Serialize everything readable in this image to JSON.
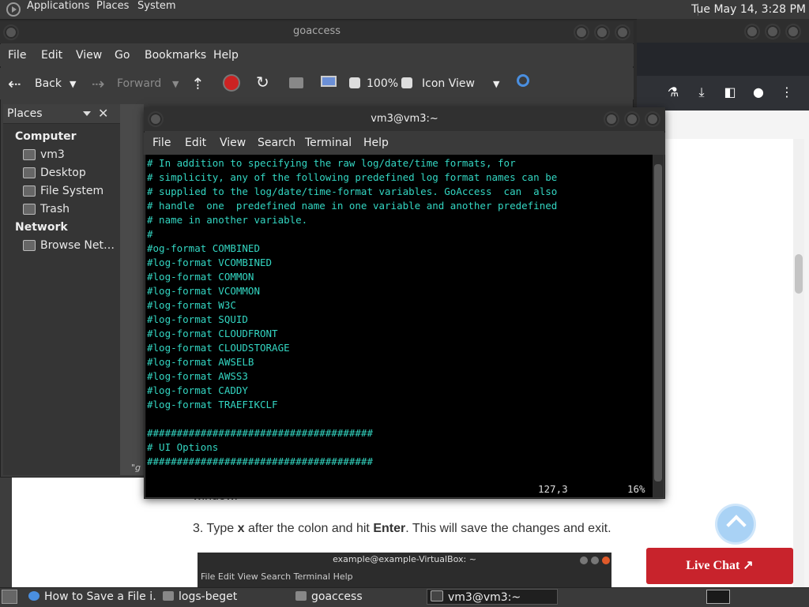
{
  "top_panel": {
    "menus": [
      "Applications",
      "Places",
      "System"
    ],
    "clock": "Tue May 14,  3:28 PM"
  },
  "file_manager": {
    "title": "goaccess",
    "menus": [
      "File",
      "Edit",
      "View",
      "Go",
      "Bookmarks",
      "Help"
    ],
    "toolbar": {
      "back": "Back",
      "forward": "Forward",
      "zoom": "100%",
      "view_mode": "Icon View"
    },
    "places": {
      "header": "Places",
      "sections": [
        {
          "title": "Computer",
          "items": [
            "vm3",
            "Desktop",
            "File System",
            "Trash"
          ]
        },
        {
          "title": "Network",
          "items": [
            "Browse Net…"
          ]
        }
      ]
    },
    "status_fragment": "\"g"
  },
  "terminal": {
    "title": "vm3@vm3:~",
    "menus": [
      "File",
      "Edit",
      "View",
      "Search",
      "Terminal",
      "Help"
    ],
    "lines": [
      "# In addition to specifying the raw log/date/time formats, for",
      "# simplicity, any of the following predefined log format names can be",
      "# supplied to the log/date/time-format variables. GoAccess  can  also",
      "# handle  one  predefined name in one variable and another predefined",
      "# name in another variable.",
      "#",
      "#og-format COMBINED",
      "#log-format VCOMBINED",
      "#log-format COMMON",
      "#log-format VCOMMON",
      "#log-format W3C",
      "#log-format SQUID",
      "#log-format CLOUDFRONT",
      "#log-format CLOUDSTORAGE",
      "#log-format AWSELB",
      "#log-format AWSS3",
      "#log-format CADDY",
      "#log-format TRAEFIKCLF",
      "",
      "######################################",
      "# UI Options",
      "######################################"
    ],
    "status_position": "127,3",
    "status_percent": "16%"
  },
  "browser": {
    "page_text_top": "window.",
    "step_number": "3.",
    "step_text_1": " Type ",
    "step_key_1": "x",
    "step_text_2": " after the colon and hit ",
    "step_key_2": "Enter",
    "step_text_3": ". This will save the changes and exit.",
    "live_chat": "Live Chat ↗",
    "embedded_title": "example@example-VirtualBox: ~",
    "embedded_menus": "File  Edit  View  Search  Terminal  Help"
  },
  "taskbar": {
    "items": [
      "How to Save a File i…",
      "logs-beget",
      "goaccess",
      "vm3@vm3:~"
    ]
  },
  "colors": {
    "terminal_text": "#33d6c2",
    "live_chat_bg": "#c8232c",
    "scroll_up_bg": "#a9d2f5"
  }
}
